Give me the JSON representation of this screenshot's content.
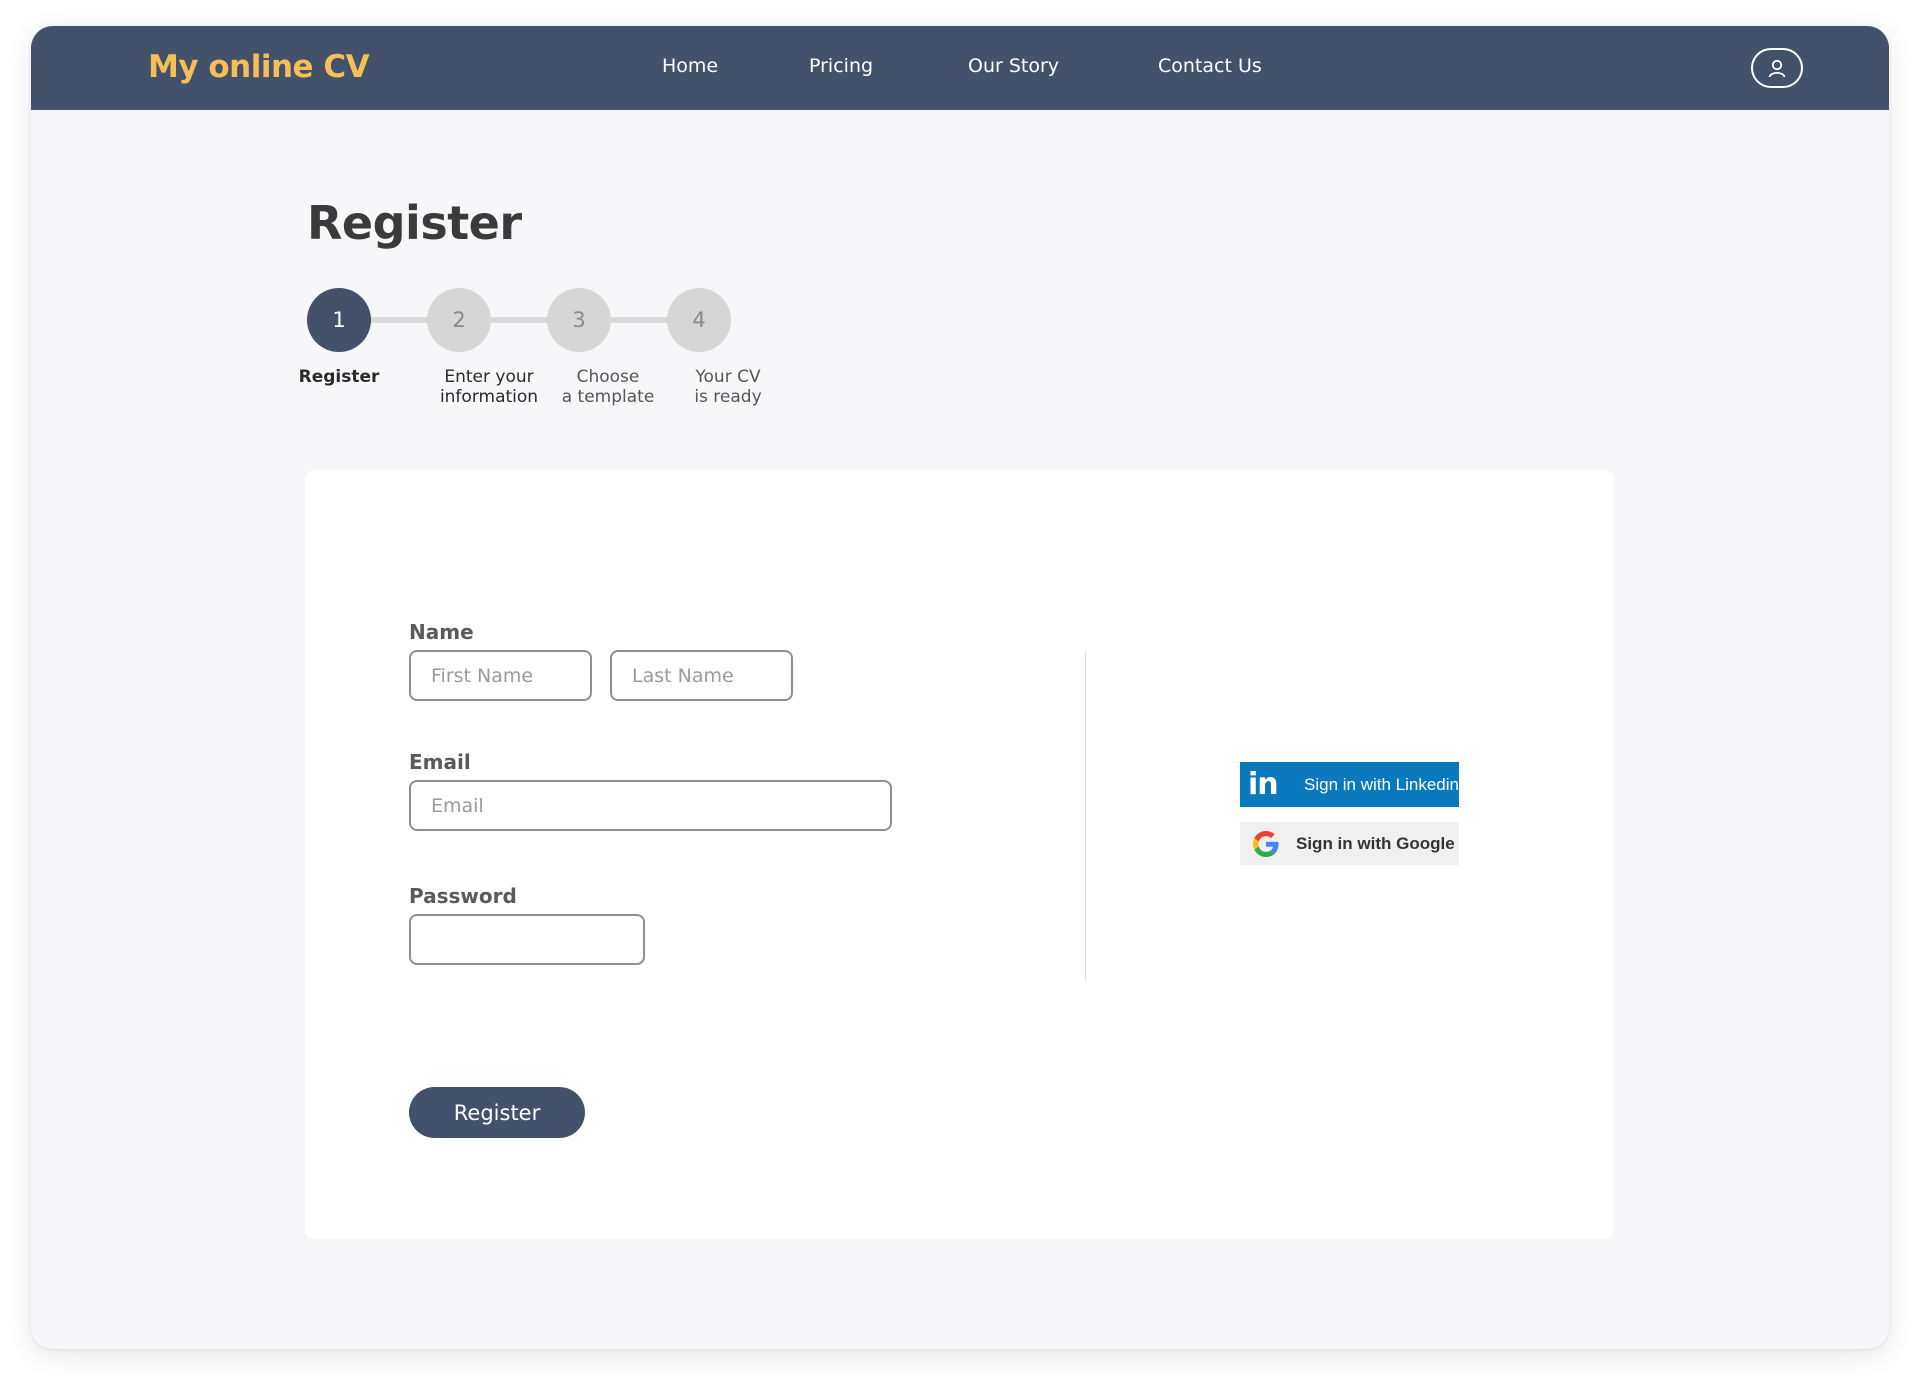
{
  "navbar": {
    "brand": "My online CV",
    "links": [
      "Home",
      "Pricing",
      "Our Story",
      "Contact Us"
    ],
    "profile_icon": "user-icon"
  },
  "page": {
    "title": "Register"
  },
  "stepper": {
    "active_step": 1,
    "steps": [
      {
        "number": "1",
        "label_line1": "Register",
        "label_line2": ""
      },
      {
        "number": "2",
        "label_line1": "Enter your",
        "label_line2": "information"
      },
      {
        "number": "3",
        "label_line1": "Choose",
        "label_line2": "a template"
      },
      {
        "number": "4",
        "label_line1": "Your CV",
        "label_line2": "is ready"
      }
    ]
  },
  "form": {
    "name_label": "Name",
    "first_name_placeholder": "First Name",
    "last_name_placeholder": "Last Name",
    "email_label": "Email",
    "email_placeholder": "Email",
    "password_label": "Password",
    "password_placeholder": "",
    "submit_label": "Register"
  },
  "social": {
    "linkedin_label": "Sign in with Linkedin",
    "linkedin_logo": "in",
    "linkedin_color": "#0a78bc",
    "google_label": "Sign in with Google"
  },
  "colors": {
    "nav_bg": "#44516b",
    "brand": "#f4bf56",
    "primary": "#44516b",
    "page_bg": "#f7f7f9"
  }
}
